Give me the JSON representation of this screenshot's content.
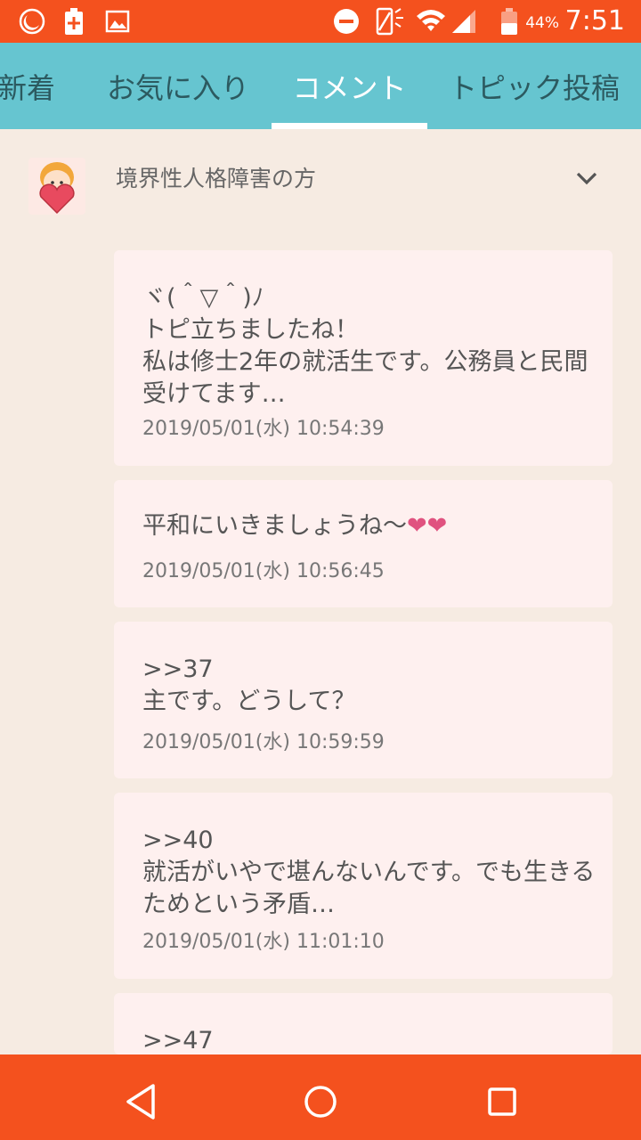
{
  "status_bar": {
    "time": "7:51",
    "battery_percent": "44%",
    "icons": [
      "moon-icon",
      "battery-plus-icon",
      "image-icon",
      "dnd-icon",
      "rotate-icon",
      "wifi-icon",
      "signal-icon",
      "battery-icon"
    ]
  },
  "tabs": [
    {
      "label": "新着"
    },
    {
      "label": "お気に入り"
    },
    {
      "label": "コメント"
    },
    {
      "label": "トピック投稿"
    }
  ],
  "active_tab": "コメント",
  "topic": {
    "title": "境界性人格障害の方",
    "avatar": "girl-heart-icon"
  },
  "comments": [
    {
      "text": "ヾ(＾▽＾)ﾉ\nトピ立ちましたね！\n私は修士2年の就活生です。公務員と民間受けてます…",
      "date": "2019/05/01(水) 10:54:39"
    },
    {
      "text": "平和にいきましょうね〜",
      "hearts": "❤❤",
      "date": "2019/05/01(水) 10:56:45"
    },
    {
      "text": ">>37\n主です。どうして？",
      "date": "2019/05/01(水) 10:59:59"
    },
    {
      "text": ">>40\n就活がいやで堪んないんです。でも生きるためという矛盾…",
      "date": "2019/05/01(水) 11:01:10"
    },
    {
      "text": ">>47",
      "date": ""
    }
  ],
  "colors": {
    "accent": "#f4511e",
    "tab_bar": "#66c5d0",
    "background": "#f6ebe2",
    "card": "#fef0ef"
  }
}
